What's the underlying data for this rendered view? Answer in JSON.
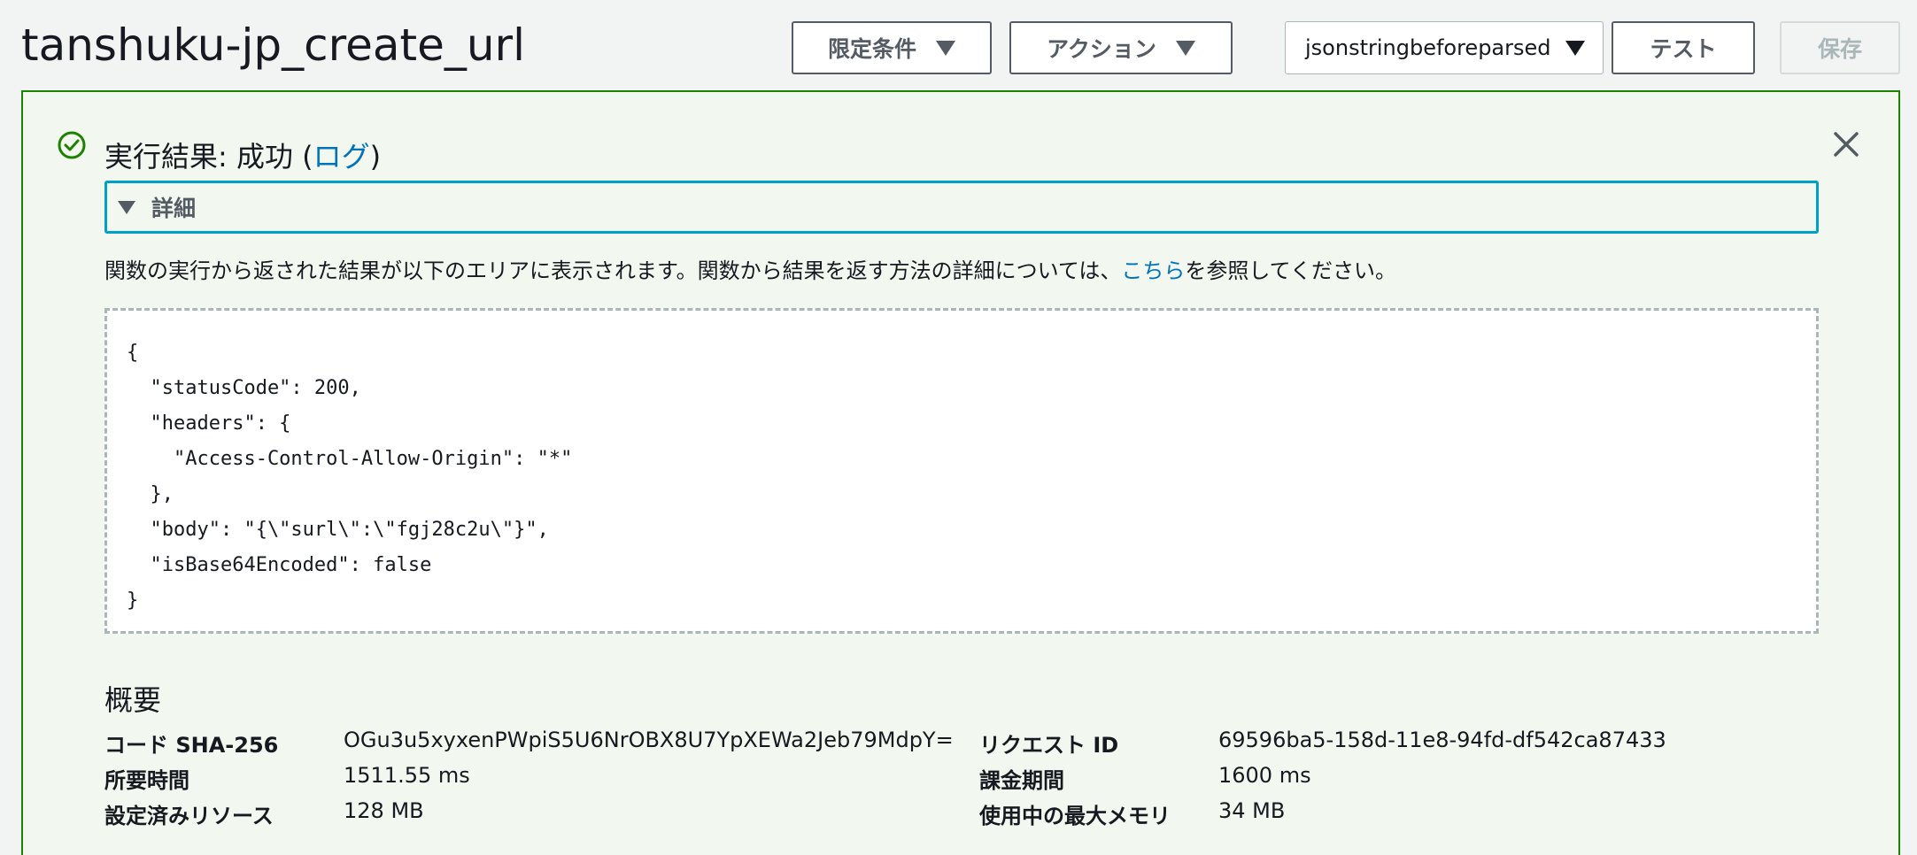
{
  "header": {
    "function_name": "tanshuku-jp_create_url",
    "qualifier_label": "限定条件",
    "actions_label": "アクション",
    "test_event_selected": "jsonstringbeforeparsed",
    "test_label": "テスト",
    "save_label": "保存"
  },
  "result": {
    "heading_prefix": "実行結果: 成功 (",
    "log_link": "ログ",
    "heading_suffix": ")",
    "details_label": "詳細",
    "description_before": "関数の実行から返された結果が以下のエリアに表示されます。関数から結果を返す方法の詳細については、",
    "description_link": "こちら",
    "description_after": "を参照してください。",
    "output": "{\n  \"statusCode\": 200,\n  \"headers\": {\n    \"Access-Control-Allow-Origin\": \"*\"\n  },\n  \"body\": \"{\\\"surl\\\":\\\"fgj28c2u\\\"}\",\n  \"isBase64Encoded\": false\n}"
  },
  "summary": {
    "title": "概要",
    "code_sha_label": "コード SHA-256",
    "code_sha_value": "OGu3u5xyxenPWpiS5U6NrOBX8U7YpXEWa2Jeb79MdpY=",
    "duration_label": "所要時間",
    "duration_value": "1511.55 ms",
    "resources_label": "設定済みリソース",
    "resources_value": "128 MB",
    "request_id_label": "リクエスト ID",
    "request_id_value": "69596ba5-158d-11e8-94fd-df542ca87433",
    "billed_label": "課金期間",
    "billed_value": "1600 ms",
    "max_memory_label": "使用中の最大メモリ",
    "max_memory_value": "34 MB"
  },
  "colors": {
    "success": "#1d8102",
    "link": "#0073bb",
    "focus": "#00a1c9"
  },
  "icons": {
    "status": "check-circle-icon",
    "close": "close-icon",
    "caret": "caret-down-icon"
  }
}
